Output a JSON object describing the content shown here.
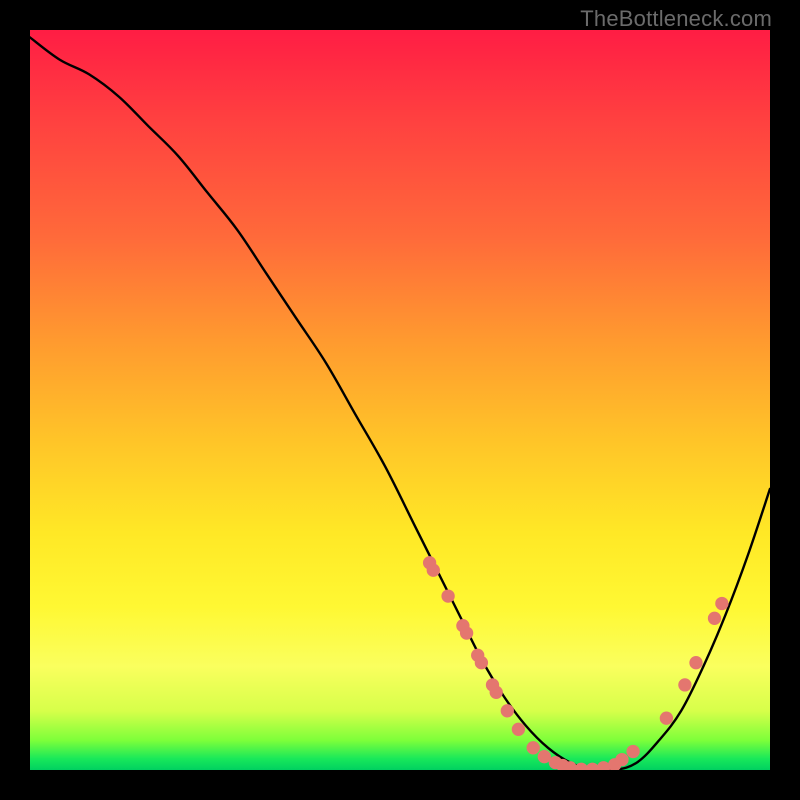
{
  "attribution": "TheBottleneck.com",
  "chart_data": {
    "type": "line",
    "title": "",
    "xlabel": "",
    "ylabel": "",
    "xlim": [
      0,
      100
    ],
    "ylim": [
      0,
      100
    ],
    "background_gradient": [
      "#ff1d44",
      "#ff9a2f",
      "#ffe826",
      "#00d060"
    ],
    "series": [
      {
        "name": "bottleneck-curve",
        "color": "#000000",
        "x": [
          0,
          4,
          8,
          12,
          16,
          20,
          24,
          28,
          32,
          36,
          40,
          44,
          48,
          52,
          55,
          58,
          61,
          64,
          67,
          70,
          73,
          76,
          79,
          82,
          85,
          88,
          91,
          94,
          97,
          100
        ],
        "y": [
          99,
          96,
          94,
          91,
          87,
          83,
          78,
          73,
          67,
          61,
          55,
          48,
          41,
          33,
          27,
          21,
          15,
          10,
          6,
          3,
          1,
          0,
          0,
          1,
          4,
          8,
          14,
          21,
          29,
          38
        ]
      }
    ],
    "markers": {
      "name": "highlight-points",
      "color": "#e4766f",
      "radius_pct": 0.9,
      "points": [
        {
          "x": 54.0,
          "y": 28.0
        },
        {
          "x": 54.5,
          "y": 27.0
        },
        {
          "x": 56.5,
          "y": 23.5
        },
        {
          "x": 58.5,
          "y": 19.5
        },
        {
          "x": 59.0,
          "y": 18.5
        },
        {
          "x": 60.5,
          "y": 15.5
        },
        {
          "x": 61.0,
          "y": 14.5
        },
        {
          "x": 62.5,
          "y": 11.5
        },
        {
          "x": 63.0,
          "y": 10.5
        },
        {
          "x": 64.5,
          "y": 8.0
        },
        {
          "x": 66.0,
          "y": 5.5
        },
        {
          "x": 68.0,
          "y": 3.0
        },
        {
          "x": 69.5,
          "y": 1.8
        },
        {
          "x": 71.0,
          "y": 1.0
        },
        {
          "x": 72.0,
          "y": 0.6
        },
        {
          "x": 73.0,
          "y": 0.3
        },
        {
          "x": 74.5,
          "y": 0.1
        },
        {
          "x": 76.0,
          "y": 0.1
        },
        {
          "x": 77.5,
          "y": 0.3
        },
        {
          "x": 79.0,
          "y": 0.7
        },
        {
          "x": 80.0,
          "y": 1.4
        },
        {
          "x": 81.5,
          "y": 2.5
        },
        {
          "x": 86.0,
          "y": 7.0
        },
        {
          "x": 88.5,
          "y": 11.5
        },
        {
          "x": 90.0,
          "y": 14.5
        },
        {
          "x": 92.5,
          "y": 20.5
        },
        {
          "x": 93.5,
          "y": 22.5
        }
      ]
    }
  }
}
